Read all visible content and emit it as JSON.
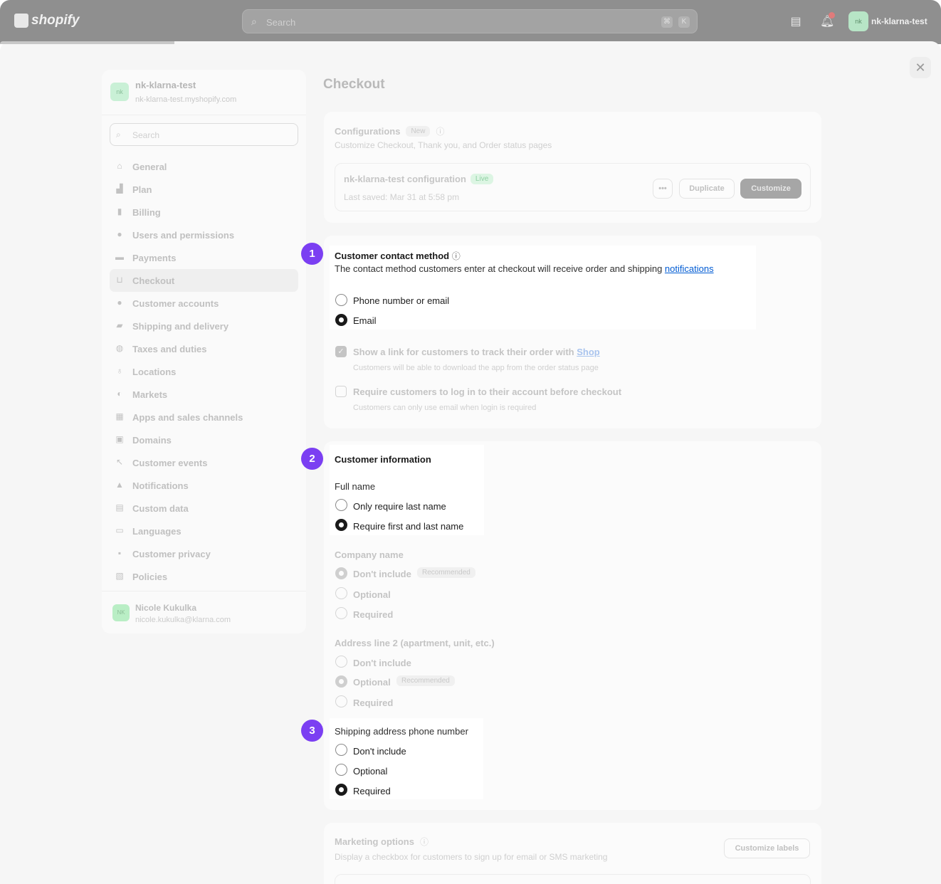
{
  "topbar": {
    "logo_text": "shopify",
    "search_placeholder": "Search",
    "kbd1": "⌘",
    "kbd2": "K",
    "store_avatar": "nk",
    "store_name": "nk-klarna-test"
  },
  "sidebar": {
    "store_avatar": "nk",
    "store_name": "nk-klarna-test",
    "store_url": "nk-klarna-test.myshopify.com",
    "search_placeholder": "Search",
    "items": [
      {
        "label": "General",
        "icon": "store-icon"
      },
      {
        "label": "Plan",
        "icon": "plan-icon"
      },
      {
        "label": "Billing",
        "icon": "billing-icon"
      },
      {
        "label": "Users and permissions",
        "icon": "users-icon"
      },
      {
        "label": "Payments",
        "icon": "payments-icon"
      },
      {
        "label": "Checkout",
        "icon": "cart-icon",
        "active": true
      },
      {
        "label": "Customer accounts",
        "icon": "person-icon"
      },
      {
        "label": "Shipping and delivery",
        "icon": "truck-icon"
      },
      {
        "label": "Taxes and duties",
        "icon": "tax-icon"
      },
      {
        "label": "Locations",
        "icon": "location-icon"
      },
      {
        "label": "Markets",
        "icon": "globe-icon"
      },
      {
        "label": "Apps and sales channels",
        "icon": "apps-icon"
      },
      {
        "label": "Domains",
        "icon": "domain-icon"
      },
      {
        "label": "Customer events",
        "icon": "events-icon"
      },
      {
        "label": "Notifications",
        "icon": "bell-icon"
      },
      {
        "label": "Custom data",
        "icon": "data-icon"
      },
      {
        "label": "Languages",
        "icon": "language-icon"
      },
      {
        "label": "Customer privacy",
        "icon": "lock-icon"
      },
      {
        "label": "Policies",
        "icon": "policy-icon"
      }
    ],
    "user_avatar": "NK",
    "user_name": "Nicole Kukulka",
    "user_email": "nicole.kukulka@klarna.com"
  },
  "main": {
    "title": "Checkout",
    "configurations": {
      "title": "Configurations",
      "badge": "New",
      "subtitle": "Customize Checkout, Thank you, and Order status pages",
      "config_name": "nk-klarna-test configuration",
      "status": "Live",
      "last_saved": "Last saved: Mar 31 at 5:58 pm",
      "more": "•••",
      "duplicate": "Duplicate",
      "customize": "Customize"
    },
    "contact": {
      "step": "1",
      "title": "Customer contact method",
      "desc": "The contact method customers enter at checkout will receive order and shipping",
      "desc_link": "notifications",
      "options": [
        "Phone number or email",
        "Email"
      ],
      "selected": "Email",
      "shop_check_label": "Show a link for customers to track their order with",
      "shop_link": "Shop",
      "shop_check_help": "Customers will be able to download the app from the order status page",
      "login_check_label": "Require customers to log in to their account before checkout",
      "login_check_help": "Customers can only use email when login is required"
    },
    "info": {
      "step": "2",
      "title": "Customer information",
      "fullname_label": "Full name",
      "fullname_options": [
        "Only require last name",
        "Require first and last name"
      ],
      "fullname_selected": "Require first and last name",
      "company_label": "Company name",
      "company_options": [
        "Don't include",
        "Optional",
        "Required"
      ],
      "company_recommended": "Recommended",
      "address2_label": "Address line 2 (apartment, unit, etc.)",
      "address2_options": [
        "Don't include",
        "Optional",
        "Required"
      ],
      "address2_recommended": "Recommended"
    },
    "phone": {
      "step": "3",
      "label": "Shipping address phone number",
      "options": [
        "Don't include",
        "Optional",
        "Required"
      ],
      "selected": "Required"
    },
    "marketing": {
      "title": "Marketing options",
      "subtitle": "Display a checkbox for customers to sign up for email or SMS marketing",
      "button": "Customize labels"
    }
  }
}
